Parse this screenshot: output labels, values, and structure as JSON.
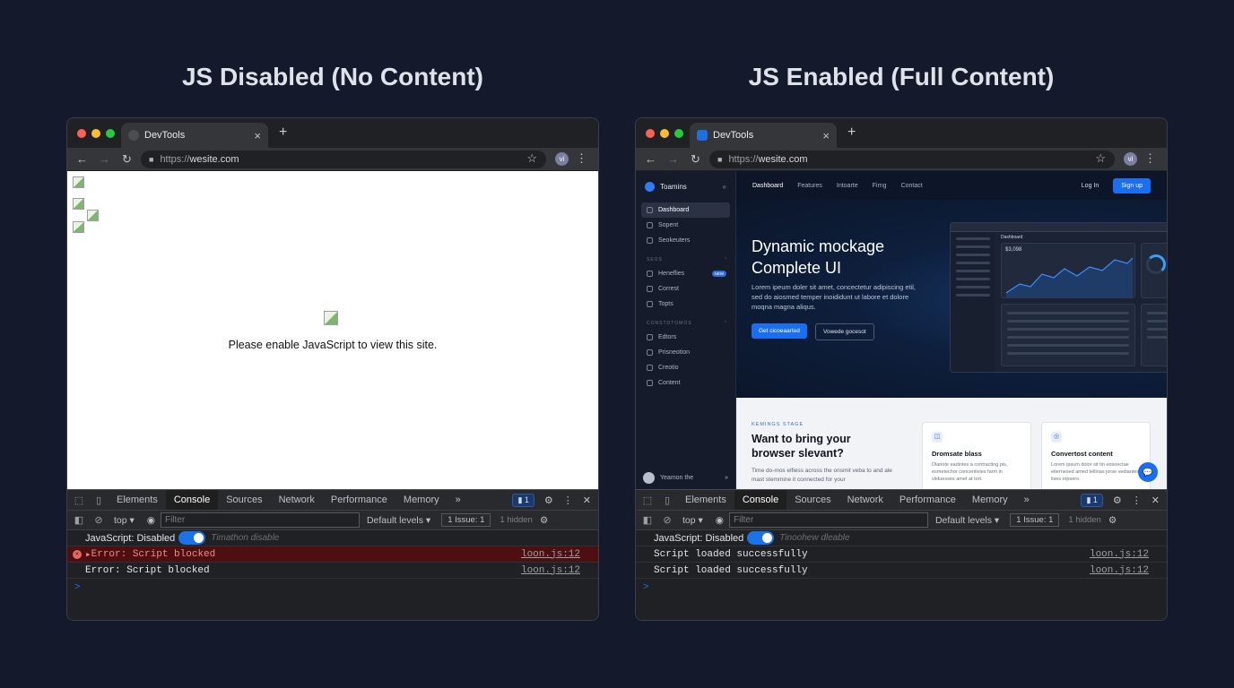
{
  "headings": {
    "left": "JS Disabled (No Content)",
    "right": "JS Enabled (Full Content)"
  },
  "browser": {
    "tab_title": "DevTools",
    "tab_close": "×",
    "new_tab": "+",
    "url_proto": "https://",
    "url_host": "wesite.com",
    "avatar_text": "vi",
    "nav": {
      "back": "←",
      "forward": "→",
      "reload": "↻"
    },
    "star": "☆",
    "menu": "⋮",
    "lock": "🔒"
  },
  "colors": {
    "accent": "#1a73e8",
    "error_bg": "#4d0f10",
    "error_text": "#f28b82",
    "traffic": [
      "#ff5f57",
      "#febc2e",
      "#28c840"
    ]
  },
  "left": {
    "noscript_text": "Please enable JavaScript to view this site."
  },
  "devtools": {
    "tabs": [
      "Elements",
      "Console",
      "Sources",
      "Network",
      "Performance",
      "Memory"
    ],
    "active_tab": "Console",
    "more": "»",
    "messages_badge": "1",
    "context": "top ▾",
    "filter_placeholder": "Filter",
    "levels": "Default levels ▾"
  },
  "left_console": {
    "issues": "1 Issue: 1",
    "hidden": "1 hidden",
    "js_label": "JavaScript: Disabled",
    "toggle_hint": "Timathon disable",
    "rows": [
      {
        "text": "Error: Script blocked",
        "link": "loon.js:12"
      },
      {
        "text": "Error: Script blocked",
        "link": "loon.js:12"
      }
    ],
    "prompt": ">"
  },
  "right_console": {
    "issues": "1 Issue: 1",
    "hidden": "1 hidden",
    "js_label": "JavaScript: Disabled",
    "toggle_hint": "Tinoohew dleable",
    "rows": [
      {
        "text": "Script loaded successfully",
        "link": "loon.js:12"
      },
      {
        "text": "Script loaded successfully",
        "link": "loon.js:12"
      }
    ],
    "prompt": ">"
  },
  "site": {
    "brand": "Toamins",
    "collapse": "«",
    "sidebar_main": [
      "Dashboard",
      "Sopent",
      "Seokeuters"
    ],
    "section1": "SEOS",
    "section1_items": [
      "Heneflies",
      "Correst",
      "Topts"
    ],
    "new_badge": "NEW",
    "section2": "CONSTOTOMOS",
    "section2_items": [
      "Edtors",
      "Prisneotion",
      "Creotio",
      "Content"
    ],
    "user_name": "Yeamon the",
    "user_arrow": "»",
    "topnav": [
      "Dashboard",
      "Features",
      "Intoarte",
      "Firng",
      "Contact"
    ],
    "login": "Log In",
    "signup": "Sign up",
    "hero_title": "Dynamic mockage Complete UI",
    "hero_desc": "Lorem ipeum doler sit amet, concectetur adipiscing etil, sed do aiosmed temper inoididunt ut labore et dolore moqna magna aliqus.",
    "btn_primary": "Get cicoeaarted",
    "btn_secondary": "Vowede gocesot",
    "mock_value": "$3,098",
    "mock_title": "Dashboard",
    "section_tag": "KEMINGS STAGE",
    "section_title": "Want to bring your browser slevant?",
    "section_desc": "Time do-mos elfiess across the onsmit veba to and ale mast stemmine it connected for your",
    "cards": [
      {
        "icon": "◫",
        "title": "Dromsate blass",
        "desc": "Dlanote eadintes a contracting pis, esmetechor concentivies farm in viiduesses amet at tort."
      },
      {
        "icon": "◎",
        "title": "Convertost content",
        "desc": "Lorem ipsum dolor sit tin eosoectae eiternesed amed tellinas jorse vediantes lises orpsero."
      }
    ],
    "chat_icon": "💬"
  }
}
